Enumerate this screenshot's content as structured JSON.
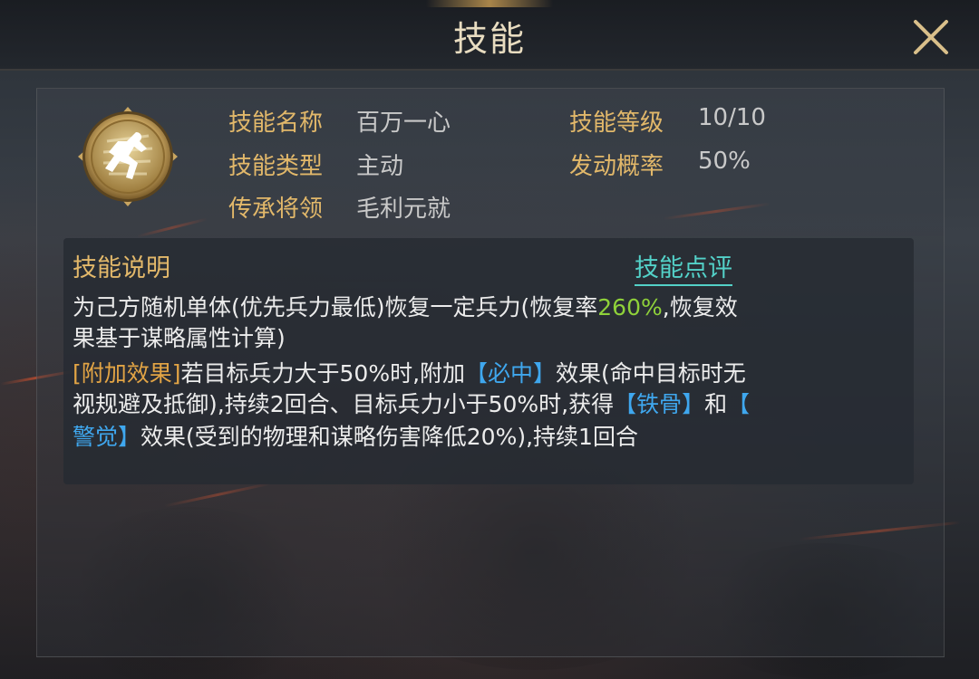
{
  "header": {
    "title": "技能"
  },
  "skill": {
    "icon": "running-figure-icon",
    "name_label": "技能名称",
    "name_value": "百万一心",
    "level_label": "技能等级",
    "level_value": "10/10",
    "type_label": "技能类型",
    "type_value": "主动",
    "rate_label": "发动概率",
    "rate_value": "50%",
    "inherit_label": "传承将领",
    "inherit_value": "毛利元就"
  },
  "description": {
    "title": "技能说明",
    "review_link": "技能点评",
    "line1_a": "为己方随机单体(优先兵力最低)恢复一定兵力(恢复率",
    "line1_rate": "260%",
    "line1_b": ",恢复效",
    "line2": "果基于谋略属性计算)",
    "line3_tag": "[附加效果]",
    "line3_a": "若目标兵力大于50%时,附加",
    "line3_effect": "【必中】",
    "line3_b": "效果(命中目标时无",
    "line4_a": "视规避及抵御),持续2回合、目标兵力小于50%时,获得",
    "line4_effect1": "【铁骨】",
    "line4_and": "和",
    "line4_bracket": "【",
    "line5_effect2": "警觉】",
    "line5_a": "效果(受到的物理和谋略伤害降低20%),持续1回合"
  },
  "colors": {
    "label_gold": "#e2b86a",
    "value_gray": "#c9c9c9",
    "highlight_green": "#8fd13a",
    "highlight_blue": "#3fa7ee",
    "highlight_orange": "#e2a445",
    "link_cyan": "#53d1c8"
  }
}
